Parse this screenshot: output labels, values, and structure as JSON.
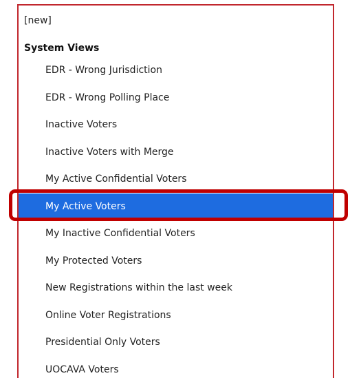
{
  "panel": {
    "new_label": "[new]",
    "group_heading": "System Views",
    "views": [
      {
        "label": "EDR - Wrong Jurisdiction",
        "selected": false
      },
      {
        "label": "EDR - Wrong Polling Place",
        "selected": false
      },
      {
        "label": "Inactive Voters",
        "selected": false
      },
      {
        "label": "Inactive Voters with Merge",
        "selected": false
      },
      {
        "label": "My Active Confidential Voters",
        "selected": false
      },
      {
        "label": "My Active Voters",
        "selected": true
      },
      {
        "label": "My Inactive Confidential Voters",
        "selected": false
      },
      {
        "label": "My Protected Voters",
        "selected": false
      },
      {
        "label": "New Registrations within the last week",
        "selected": false
      },
      {
        "label": "Online Voter Registrations",
        "selected": false
      },
      {
        "label": "Presidential Only Voters",
        "selected": false
      },
      {
        "label": "UOCAVA Voters",
        "selected": false
      }
    ]
  },
  "colors": {
    "panel_border": "#c1272d",
    "selected_background": "#1e6ce0",
    "selected_text": "#ffffff",
    "callout_outline": "#c00000"
  }
}
